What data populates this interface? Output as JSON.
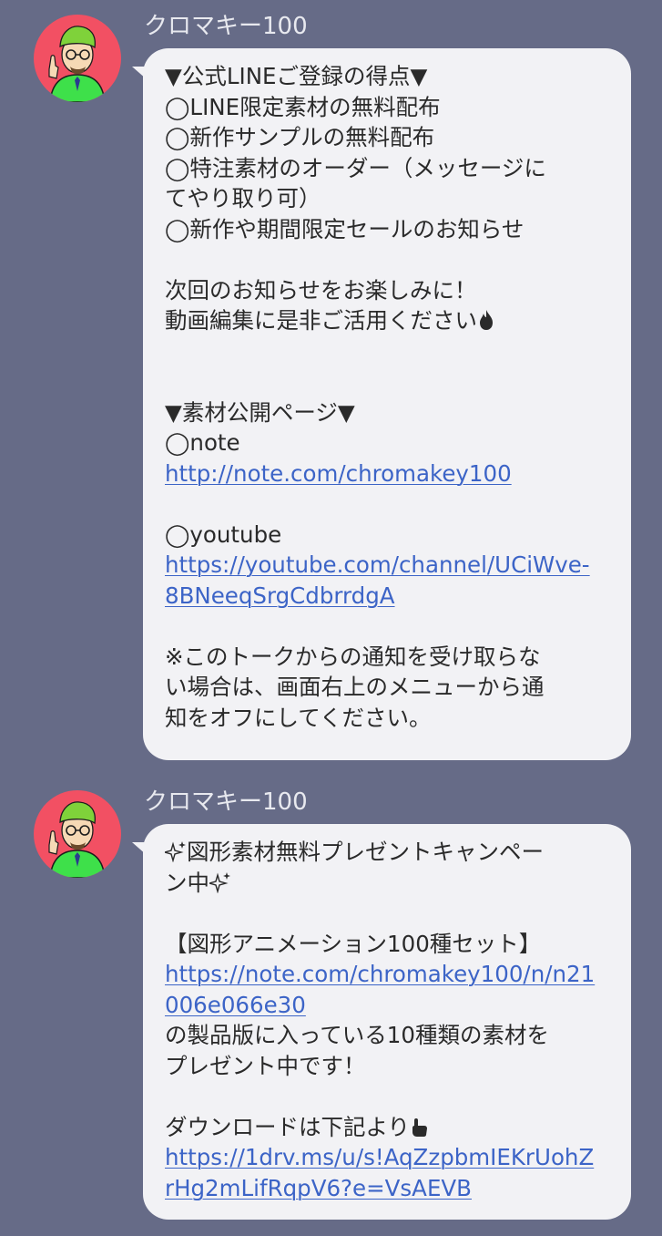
{
  "messages": [
    {
      "sender": "クロマキー100",
      "lines": {
        "l1": "▼公式LINEご登録の得点▼",
        "l2": "◯LINE限定素材の無料配布",
        "l3": "◯新作サンプルの無料配布",
        "l4": "◯特注素材のオーダー（メッセージに",
        "l5": "てやり取り可）",
        "l6": "◯新作や期間限定セールのお知らせ",
        "l7": "次回のお知らせをお楽しみに！",
        "l8": "動画編集に是非ご活用ください",
        "l9": "▼素材公開ページ▼",
        "l10": "◯note",
        "l11": "http://note.com/chromakey100",
        "l12": "◯youtube",
        "l13": "https://youtube.com/channel/UCiWve-",
        "l14": "8BNeeqSrgCdbrrdgA",
        "l15": "※このトークからの通知を受け取らな",
        "l16": "い場合は、画面右上のメニューから通",
        "l17": "知をオフにしてください。"
      }
    },
    {
      "sender": "クロマキー100",
      "lines": {
        "l1": "図形素材無料プレゼントキャンペー",
        "l2": "ン中",
        "l3": "【図形アニメーション100種セット】",
        "l4": "https://note.com/chromakey100/n/n21",
        "l5": "006e066e30",
        "l6": "の製品版に入っている10種類の素材を",
        "l7": "プレゼント中です！",
        "l8": "ダウンロードは下記より",
        "l9": "https://1drv.ms/u/s!AqZzpbmIEKrUohZ",
        "l10": "rHg2mLifRqpV6?e=VsAEVB"
      }
    }
  ],
  "icons": {
    "avatar": "cartoon-man-green-hat-avatar",
    "fire": "fire-emoji",
    "sparkles": "sparkles-emoji",
    "pointing": "pointing-hand-emoji"
  },
  "colors": {
    "background": "#666b87",
    "bubble": "#f2f2f5",
    "link": "#3c64c7",
    "avatar_bg": "#f25063"
  }
}
